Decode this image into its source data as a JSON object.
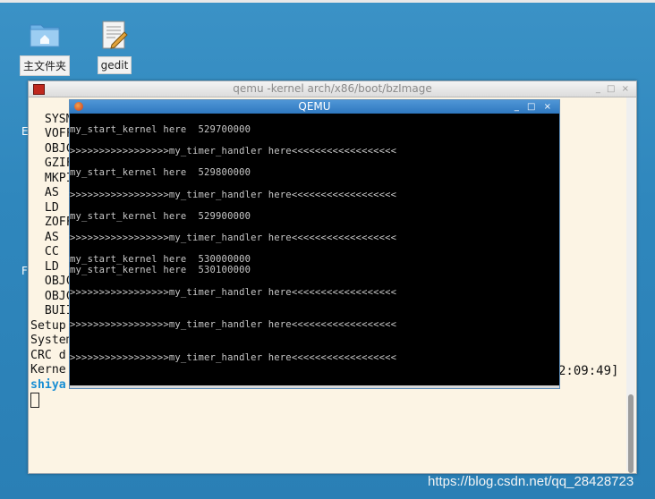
{
  "desktop": {
    "icons": [
      {
        "label": "主文件夹"
      },
      {
        "label": "gedit"
      }
    ]
  },
  "terminal": {
    "title": "qemu -kernel arch/x86/boot/bzImage",
    "lines": [
      "SYSM",
      "VOFF",
      "OBJC",
      "GZIF",
      "MKPI",
      "AS",
      "LD",
      "ZOFF",
      "AS",
      "CC",
      "LD",
      "OBJC",
      "OBJC",
      "BUII",
      "Setup",
      "System",
      "CRC d",
      "Kerne"
    ],
    "prompt": "shiya",
    "time_fragment": "2:09:49]",
    "side_letters": [
      "E",
      "F"
    ]
  },
  "qemu": {
    "title": "QEMU",
    "output": [
      "my_start_kernel here  529700000",
      ">>>>>>>>>>>>>>>>>my_timer_handler here<<<<<<<<<<<<<<<<<<",
      "my_start_kernel here  529800000",
      ">>>>>>>>>>>>>>>>>my_timer_handler here<<<<<<<<<<<<<<<<<<",
      "my_start_kernel here  529900000",
      ">>>>>>>>>>>>>>>>>my_timer_handler here<<<<<<<<<<<<<<<<<<",
      "my_start_kernel here  530000000",
      "my_start_kernel here  530100000",
      ">>>>>>>>>>>>>>>>>my_timer_handler here<<<<<<<<<<<<<<<<<<",
      ">>>>>>>>>>>>>>>>>my_timer_handler here<<<<<<<<<<<<<<<<<<",
      ">>>>>>>>>>>>>>>>>my_timer_handler here<<<<<<<<<<<<<<<<<<"
    ]
  },
  "watermark": "https://blog.csdn.net/qq_28428723",
  "colors": {
    "desktop_bg": "#2f87bd",
    "terminal_bg": "#fcf4e4",
    "qemu_title_bg": "#3a86cc",
    "prompt": "#1a8fd4"
  }
}
